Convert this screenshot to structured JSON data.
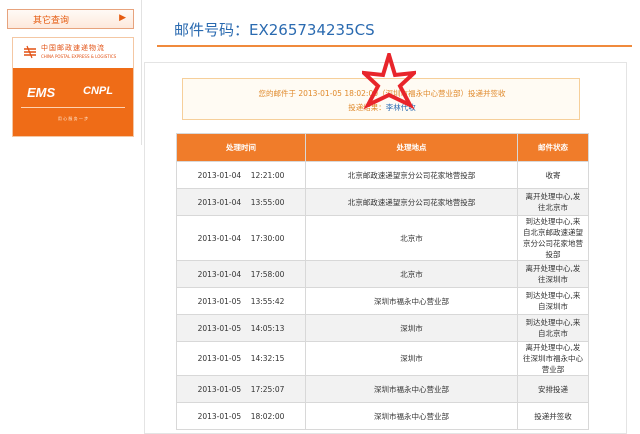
{
  "sidebar": {
    "query_button_label": "其它查询",
    "query_button_arrow": "▶",
    "ems_card": {
      "cn_name": "中国邮政速递物流",
      "en_name": "CHINA POSTAL EXPRESS & LOGISTICS",
      "ems_mark": "EMS",
      "cnpl_mark": "CNPL",
      "tagline": "用 心 服 务 一 步"
    }
  },
  "header": {
    "title": "邮件号码：EX265734235CS"
  },
  "notice": {
    "line1": "您的邮件于 2013-01-05 18:02:00（深圳市福永中心营业部）投递并签收",
    "line2_prefix": "投递结果：",
    "signer": "李林代收"
  },
  "table": {
    "headers": [
      "处理时间",
      "处理地点",
      "邮件状态"
    ],
    "rows": [
      {
        "date": "2013-01-04",
        "time": "12:21:00",
        "place": "北京邮政速递望京分公司花家地营投部",
        "status": "收寄"
      },
      {
        "date": "2013-01-04",
        "time": "13:55:00",
        "place": "北京邮政速递望京分公司花家地营投部",
        "status": "离开处理中心,发往北京市"
      },
      {
        "date": "2013-01-04",
        "time": "17:30:00",
        "place": "北京市",
        "status": "到达处理中心,来自北京邮政速递望京分公司花家地营投部"
      },
      {
        "date": "2013-01-04",
        "time": "17:58:00",
        "place": "北京市",
        "status": "离开处理中心,发往深圳市"
      },
      {
        "date": "2013-01-05",
        "time": "13:55:42",
        "place": "深圳市福永中心营业部",
        "status": "到达处理中心,来自深圳市"
      },
      {
        "date": "2013-01-05",
        "time": "14:05:13",
        "place": "深圳市",
        "status": "到达处理中心,来自北京市"
      },
      {
        "date": "2013-01-05",
        "time": "14:32:15",
        "place": "深圳市",
        "status": "离开处理中心,发往深圳市福永中心营业部"
      },
      {
        "date": "2013-01-05",
        "time": "17:25:07",
        "place": "深圳市福永中心营业部",
        "status": "安排投递"
      },
      {
        "date": "2013-01-05",
        "time": "18:02:00",
        "place": "深圳市福永中心营业部",
        "status": "投递并签收"
      }
    ]
  },
  "colors": {
    "accent": "#f07c2a",
    "link": "#2a6ab0",
    "notice_text": "#e08a2c",
    "annotation_star": "#e8252b"
  }
}
